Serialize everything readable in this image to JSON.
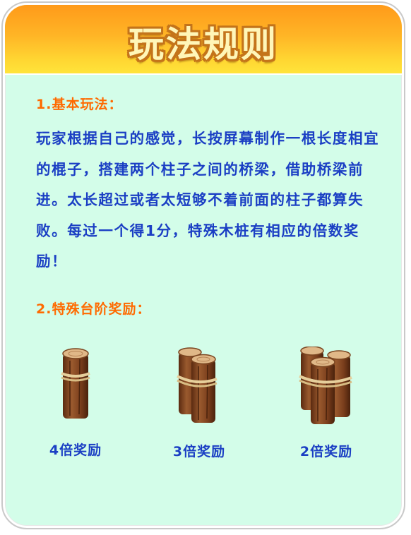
{
  "title": "玩法规则",
  "section1": {
    "heading": "1.基本玩法：",
    "text": "玩家根据自己的感觉，长按屏幕制作一根长度相宜的棍子，搭建两个柱子之间的桥梁，借助桥梁前进。太长超过或者太短够不着前面的柱子都算失败。每过一个得1分，特殊木桩有相应的倍数奖励！"
  },
  "section2": {
    "heading": "2.特殊台阶奖励：",
    "rewards": [
      {
        "label": "4倍奖励",
        "logs": 1,
        "icon": "single-log-icon"
      },
      {
        "label": "3倍奖励",
        "logs": 2,
        "icon": "double-log-icon"
      },
      {
        "label": "2倍奖励",
        "logs": 3,
        "icon": "triple-log-icon"
      }
    ]
  },
  "colors": {
    "background": "#d3fde9",
    "header_top": "#ff9a1a",
    "header_bottom": "#ffe43a",
    "heading": "#ff6a00",
    "body_text": "#1b3fc4",
    "wood": "#8a4a22",
    "rope": "#e6cf9b"
  }
}
